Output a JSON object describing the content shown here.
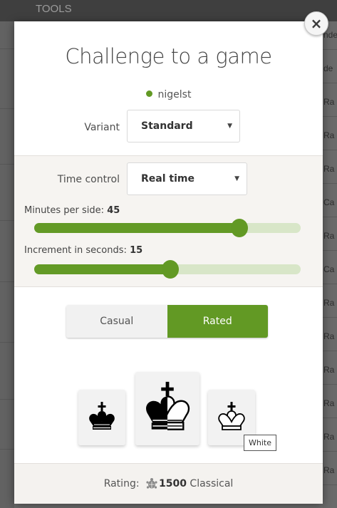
{
  "background": {
    "menu_label": "TOOLS",
    "right_cells": [
      "nde",
      "de",
      "Ra",
      "Ra",
      "Ra",
      "Ca",
      "Ra",
      "Ca",
      "Ra",
      "Ra",
      "Ra",
      "Ra",
      "Ra",
      "Ra"
    ]
  },
  "modal": {
    "title": "Challenge to a game",
    "close_icon": "×",
    "opponent": {
      "name": "nigelst",
      "status": "online"
    },
    "variant": {
      "label": "Variant",
      "value": "Standard"
    },
    "time_control": {
      "label": "Time control",
      "value": "Real time"
    },
    "minutes": {
      "label": "Minutes per side:",
      "value": "45",
      "fraction": 0.77
    },
    "increment": {
      "label": "Increment in seconds:",
      "value": "15",
      "fraction": 0.51
    },
    "mode": {
      "casual": "Casual",
      "rated": "Rated",
      "selected": "rated"
    },
    "colors": {
      "hover_tooltip": "White",
      "icons": [
        "black-king-icon",
        "random-king-icon",
        "white-king-icon"
      ]
    },
    "footer": {
      "rating_label": "Rating:",
      "rating_value": "1500",
      "rating_category": "Classical"
    }
  },
  "colors": {
    "accent": "#629924",
    "accent_light": "#d8e6c8"
  }
}
